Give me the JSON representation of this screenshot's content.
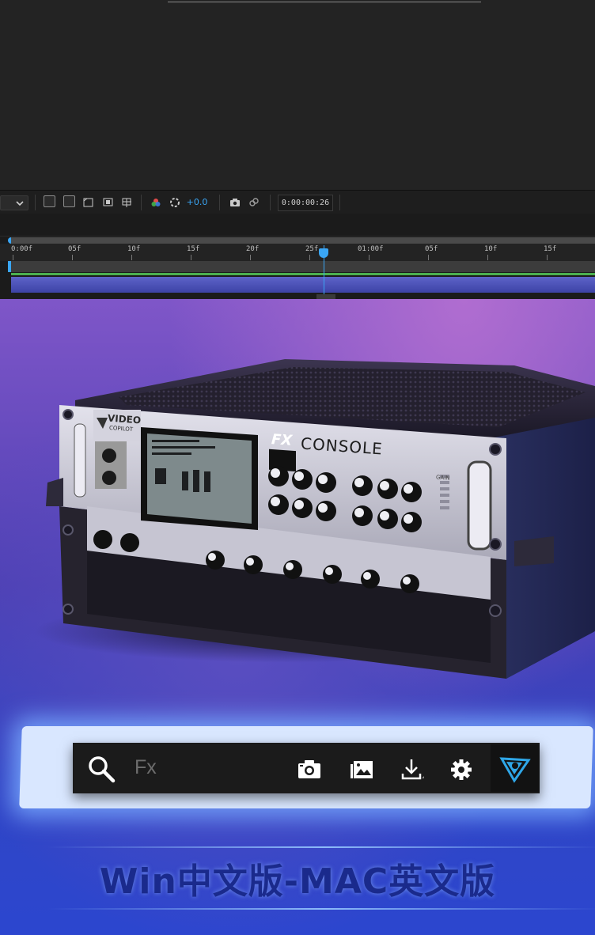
{
  "toolbar": {
    "exposure": "+0.0",
    "timecode": "0:00:00:26"
  },
  "timeline": {
    "ruler_labels": [
      "0:00f",
      "05f",
      "10f",
      "15f",
      "20f",
      "25f",
      "01:00f",
      "05f",
      "10f",
      "15f"
    ]
  },
  "product": {
    "brand": "VIDEO",
    "brand_sub": "COPILOT",
    "name_fx": "FX",
    "name_console": "CONSOLE",
    "gain_label": "GAIN"
  },
  "search": {
    "placeholder": "Fx"
  },
  "toolbar_icons": [
    "search-icon",
    "camera-icon",
    "gallery-icon",
    "download-icon",
    "gear-icon",
    "videocopilot-logo-icon"
  ],
  "footer": {
    "text": "Win中文版-MAC英文版"
  },
  "colors": {
    "accent_blue": "#3aa6f5",
    "layer_blue": "#5d63c8",
    "footer_text": "#1a2a8c"
  }
}
